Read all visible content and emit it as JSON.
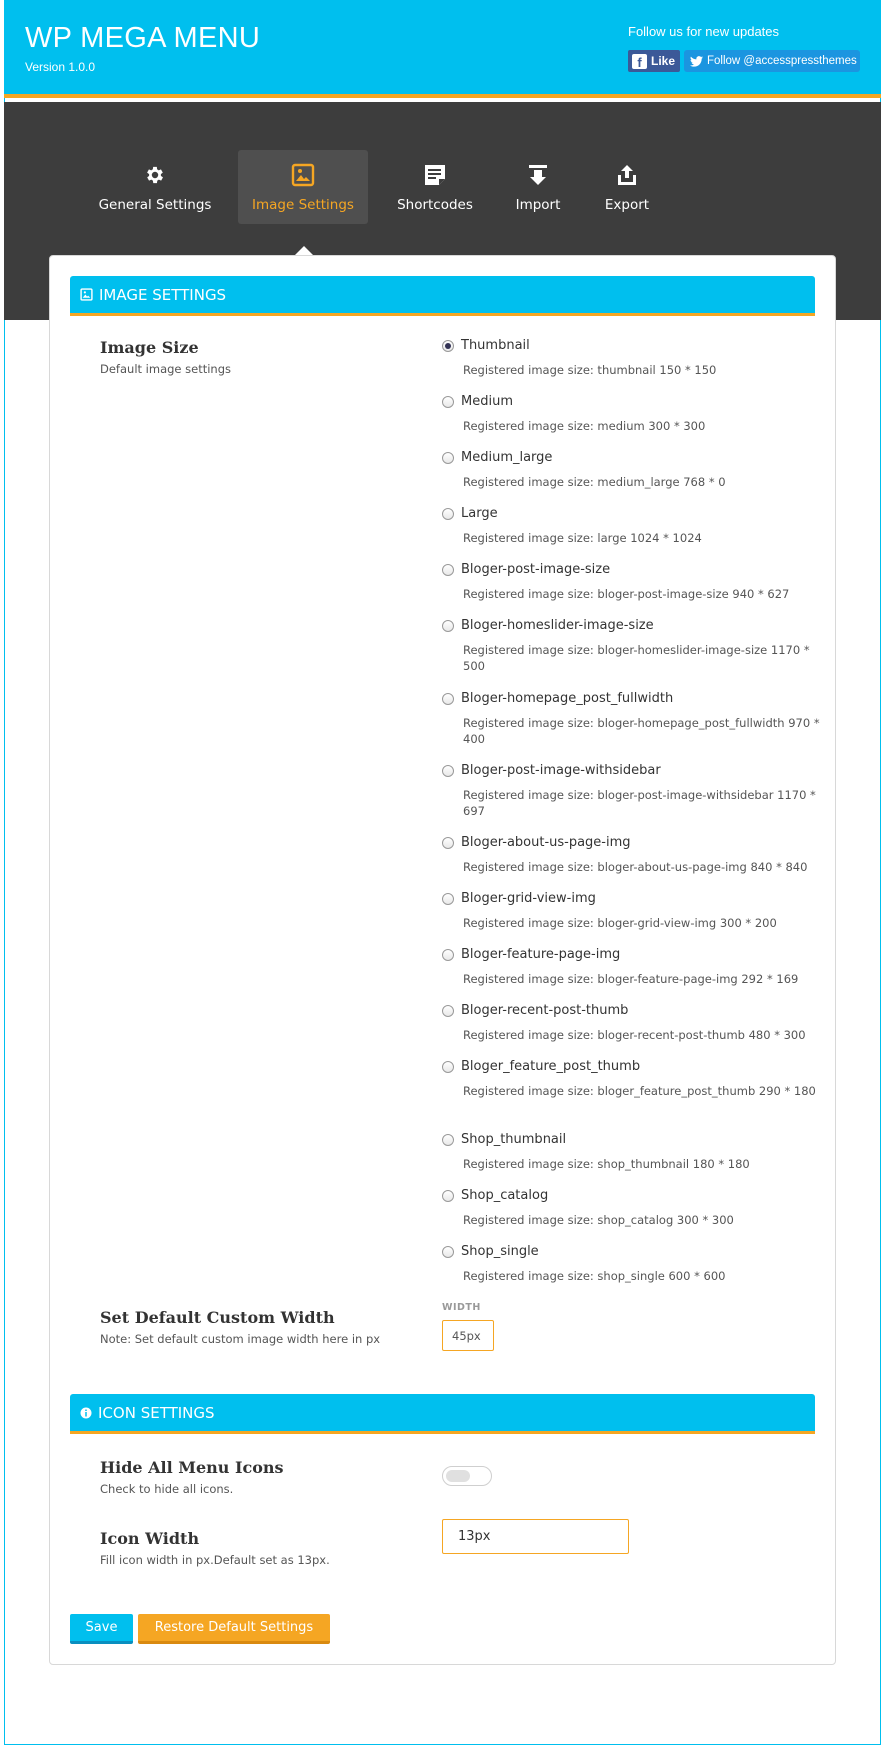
{
  "header": {
    "title": "WP MEGA MENU",
    "version": "Version 1.0.0",
    "follow_text": "Follow us for new updates",
    "fb_like": "Like",
    "twitter_follow": "Follow @accesspressthemes"
  },
  "tabs": [
    {
      "label": "General Settings",
      "icon": "gear-icon"
    },
    {
      "label": "Image Settings",
      "icon": "image-icon",
      "active": true
    },
    {
      "label": "Shortcodes",
      "icon": "note-icon"
    },
    {
      "label": "Import",
      "icon": "import-icon"
    },
    {
      "label": "Export",
      "icon": "export-icon"
    }
  ],
  "image_settings": {
    "section_title": "IMAGE SETTINGS",
    "image_size": {
      "title": "Image Size",
      "desc": "Default image settings",
      "selected": "Thumbnail",
      "options": [
        {
          "label": "Thumbnail",
          "desc": "Registered image size: thumbnail 150 * 150"
        },
        {
          "label": "Medium",
          "desc": "Registered image size: medium 300 * 300"
        },
        {
          "label": "Medium_large",
          "desc": "Registered image size: medium_large 768 * 0"
        },
        {
          "label": "Large",
          "desc": "Registered image size: large 1024 * 1024"
        },
        {
          "label": "Bloger-post-image-size",
          "desc": "Registered image size: bloger-post-image-size 940 * 627"
        },
        {
          "label": "Bloger-homeslider-image-size",
          "desc": "Registered image size: bloger-homeslider-image-size 1170 * 500"
        },
        {
          "label": "Bloger-homepage_post_fullwidth",
          "desc": "Registered image size: bloger-homepage_post_fullwidth 970 * 400"
        },
        {
          "label": "Bloger-post-image-withsidebar",
          "desc": "Registered image size: bloger-post-image-withsidebar 1170 * 697"
        },
        {
          "label": "Bloger-about-us-page-img",
          "desc": "Registered image size: bloger-about-us-page-img 840 * 840"
        },
        {
          "label": "Bloger-grid-view-img",
          "desc": "Registered image size: bloger-grid-view-img 300 * 200"
        },
        {
          "label": "Bloger-feature-page-img",
          "desc": "Registered image size: bloger-feature-page-img 292 * 169"
        },
        {
          "label": "Bloger-recent-post-thumb",
          "desc": "Registered image size: bloger-recent-post-thumb 480 * 300"
        },
        {
          "label": "Bloger_feature_post_thumb",
          "desc": "Registered image size: bloger_feature_post_thumb 290 * 180"
        },
        {
          "label": "Shop_thumbnail",
          "desc": "Registered image size: shop_thumbnail 180 * 180"
        },
        {
          "label": "Shop_catalog",
          "desc": "Registered image size: shop_catalog 300 * 300"
        },
        {
          "label": "Shop_single",
          "desc": "Registered image size: shop_single 600 * 600"
        }
      ]
    },
    "custom_width": {
      "title": "Set Default Custom Width",
      "desc": "Note: Set default custom image width here in px",
      "caption": "WIDTH",
      "value": "45px"
    }
  },
  "icon_settings": {
    "section_title": "ICON SETTINGS",
    "hide_icons": {
      "title": "Hide All Menu Icons",
      "desc": "Check to hide all icons.",
      "enabled": false
    },
    "icon_width": {
      "title": "Icon Width",
      "desc": "Fill icon width in px.Default set as 13px.",
      "value": "13px"
    }
  },
  "actions": {
    "save": "Save",
    "restore": "Restore Default Settings"
  },
  "colors": {
    "accent": "#00bfee",
    "highlight": "#f5a623",
    "nav_bg": "#3d3d3d"
  }
}
